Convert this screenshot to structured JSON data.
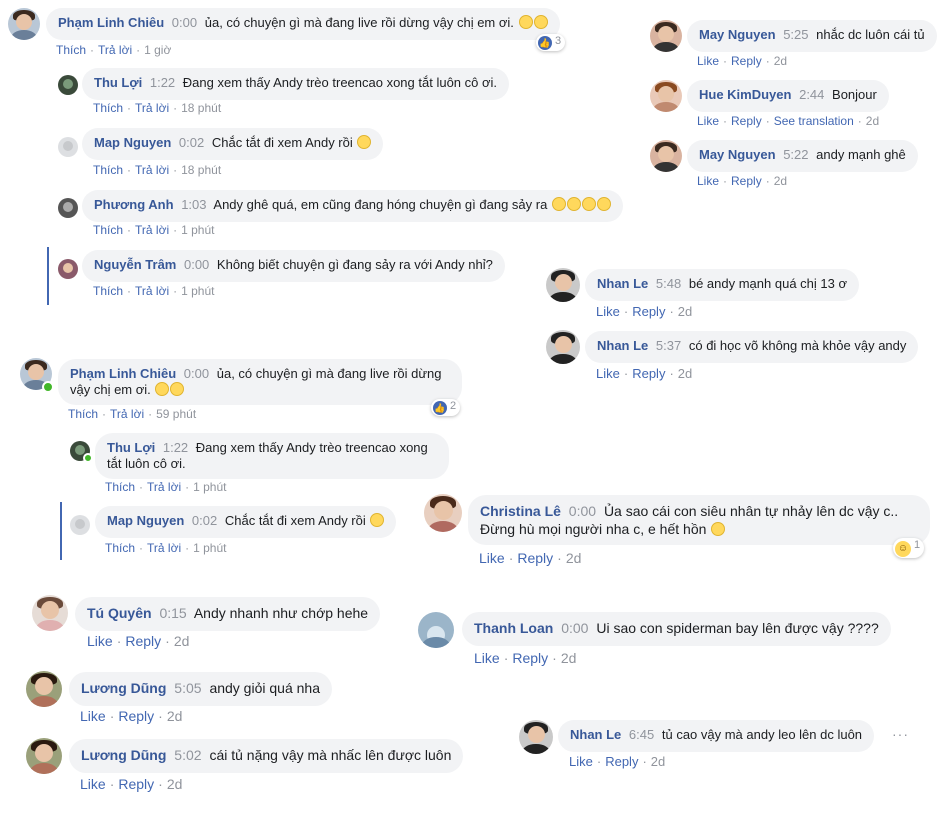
{
  "labels": {
    "like_vi": "Thích",
    "reply_vi": "Trả lời",
    "like_en": "Like",
    "reply_en": "Reply",
    "see_translation": "See translation"
  },
  "comments": [
    {
      "name": "Phạm Linh Chiêu",
      "time": "0:00",
      "text": "ủa, có chuyện gì mà đang live rồi dừng vậy chị em ơi.",
      "ago": "1 giờ",
      "reactions": "3"
    },
    {
      "name": "Thu Lợi",
      "time": "1:22",
      "text": "Đang xem thấy Andy trèo treencao xong tắt luôn cô ơi.",
      "ago": "18 phút"
    },
    {
      "name": "Map Nguyen",
      "time": "0:02",
      "text": "Chắc tắt đi xem Andy rồi",
      "ago": "18 phút"
    },
    {
      "name": "Phương Anh",
      "time": "1:03",
      "text": "Andy ghê quá, em cũng đang hóng chuyện gì đang sảy ra",
      "ago": "1 phút"
    },
    {
      "name": "Nguyễn Trâm",
      "time": "0:00",
      "text": "Không biết chuyện gì đang sảy ra với Andy nhỉ?",
      "ago": "1 phút"
    },
    {
      "name": "Phạm Linh Chiêu",
      "time": "0:00",
      "text": "ủa, có chuyện gì mà đang live rồi dừng vậy chị em ơi.",
      "ago": "59 phút",
      "reactions": "2"
    },
    {
      "name": "Thu Lợi",
      "time": "1:22",
      "text": "Đang xem thấy Andy trèo treencao xong tắt luôn cô ơi.",
      "ago": "1 phút"
    },
    {
      "name": "Map Nguyen",
      "time": "0:02",
      "text": "Chắc tắt đi xem Andy rồi",
      "ago": "1 phút"
    },
    {
      "name": "May Nguyen",
      "time": "5:25",
      "text": "nhắc dc luôn cái tủ",
      "ago": "2d"
    },
    {
      "name": "Hue KimDuyen",
      "time": "2:44",
      "text": "Bonjour",
      "ago": "2d"
    },
    {
      "name": "May Nguyen",
      "time": "5:22",
      "text": "andy mạnh ghê",
      "ago": "2d"
    },
    {
      "name": "Nhan Le",
      "time": "5:48",
      "text": "bé andy mạnh quá chị 13 ơ",
      "ago": "2d"
    },
    {
      "name": "Nhan Le",
      "time": "5:37",
      "text": "có đi học võ không mà khỏe vậy andy",
      "ago": "2d"
    },
    {
      "name": "Christina Lê",
      "time": "0:00",
      "text": "Ủa sao cái con siêu nhân tự nhảy lên dc vậy c.. Đừng hù mọi người nha c, e hết hồn",
      "ago": "2d",
      "reactions": "1"
    },
    {
      "name": "Tú Quyên",
      "time": "0:15",
      "text": "Andy nhanh như chớp hehe",
      "ago": "2d"
    },
    {
      "name": "Thanh Loan",
      "time": "0:00",
      "text": "Ui sao con spiderman bay lên được vậy ????",
      "ago": "2d"
    },
    {
      "name": "Lương Dũng",
      "time": "5:05",
      "text": "andy giỏi quá nha",
      "ago": "2d"
    },
    {
      "name": "Lương Dũng",
      "time": "5:02",
      "text": "cái tủ nặng vậy mà nhấc lên được luôn",
      "ago": "2d"
    },
    {
      "name": "Nhan Le",
      "time": "6:45",
      "text": "tủ cao vậy mà andy leo lên dc luôn",
      "ago": "2d"
    }
  ]
}
